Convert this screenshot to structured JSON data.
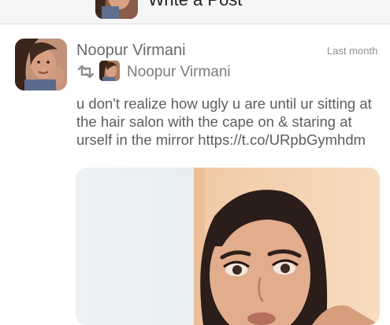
{
  "compose": {
    "label": "Write a Post"
  },
  "post": {
    "author": "Noopur Virmani",
    "timestamp": "Last month",
    "retweeted_by": "Noopur Virmani",
    "text": "u don't realize how ugly u are until ur sitting at the hair salon with the cape on & staring at urself in the mirror https://t.co/URpbGymhdm"
  },
  "icons": {
    "retweet": "retweet-icon",
    "avatar": "avatar"
  },
  "colors": {
    "name": "#6a6a6e",
    "text": "#5d5d62",
    "meta": "#8e8e93"
  }
}
